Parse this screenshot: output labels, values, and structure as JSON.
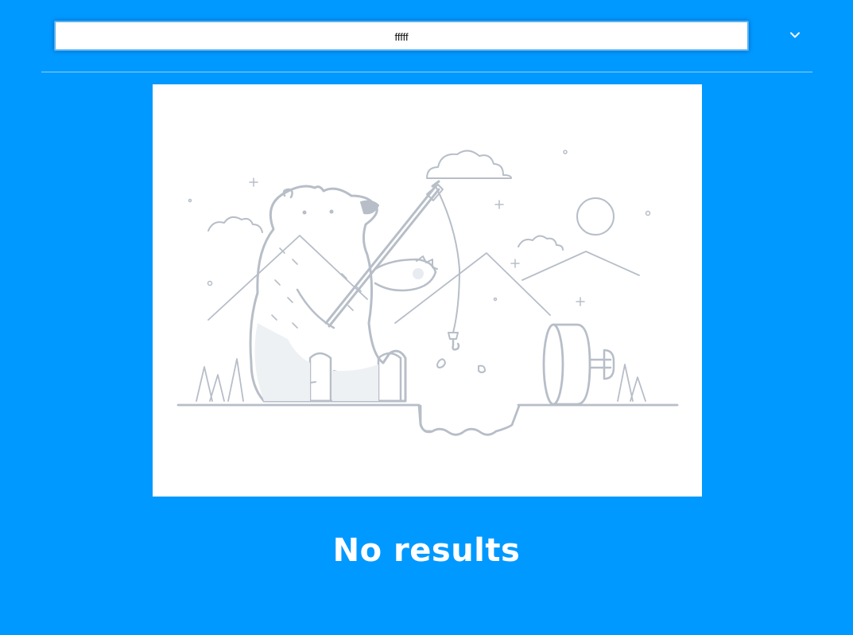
{
  "search": {
    "value": "fffff"
  },
  "results": {
    "empty_message": "No results"
  },
  "icons": {
    "dropdown": "chevron-down-icon",
    "illustration": "fishing-bear-illustration"
  },
  "colors": {
    "background": "#0099ff",
    "illustration_stroke": "#b7bec8",
    "text": "#ffffff"
  }
}
